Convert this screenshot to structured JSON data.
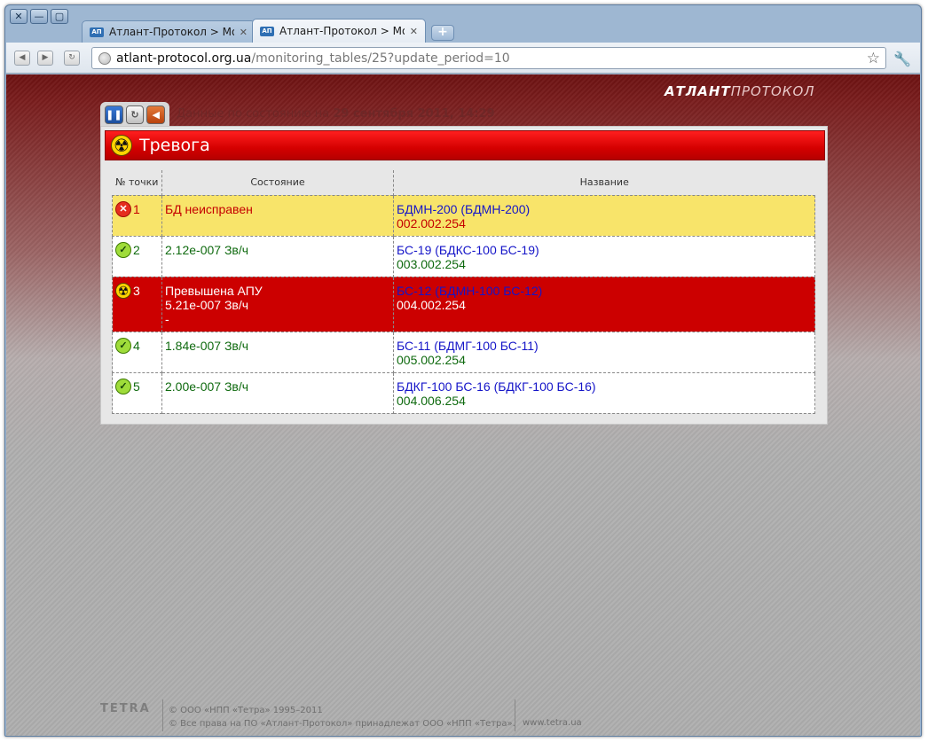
{
  "window": {
    "controls": [
      "✕",
      "—",
      "▢"
    ]
  },
  "tabs": [
    {
      "favicon": "АП",
      "title": "Атлант-Протокол > Мо...",
      "close": "✕"
    },
    {
      "favicon": "АП",
      "title": "Атлант-Протокол > Мо...",
      "close": "✕",
      "active": true
    }
  ],
  "toolbar": {
    "url_host": "atlant-protocol.org.ua",
    "url_path": "/monitoring_tables/25?update_period=10"
  },
  "page": {
    "brand_bold": "АТЛАНТ",
    "brand_light": "ПРОТОКОЛ",
    "status_prefix": "Данные по состоянию на",
    "status_date": "29 сентября 2011, 14:29",
    "alarm_title": "Тревога",
    "columns": [
      "№ точки",
      "Состояние",
      "Название"
    ],
    "rows": [
      {
        "status": "error",
        "num": "1",
        "state": [
          "БД неисправен"
        ],
        "name": "БДМН-200 (БДМН-200)",
        "code": "002.002.254",
        "style": "yellow"
      },
      {
        "status": "ok",
        "num": "2",
        "state": [
          "2.12е-007 Зв/ч"
        ],
        "name": "БС-19 (БДКС-100 БС-19)",
        "code": "003.002.254",
        "style": "white"
      },
      {
        "status": "alarm",
        "num": "3",
        "state": [
          "Превышена АПУ",
          "5.21е-007 Зв/ч",
          "-"
        ],
        "name": "БС-12 (БДМН-100 БС-12)",
        "code": "004.002.254",
        "style": "red"
      },
      {
        "status": "ok",
        "num": "4",
        "state": [
          "1.84е-007 Зв/ч"
        ],
        "name": "БС-11 (БДМГ-100 БС-11)",
        "code": "005.002.254",
        "style": "white"
      },
      {
        "status": "ok",
        "num": "5",
        "state": [
          "2.00е-007 Зв/ч"
        ],
        "name": "БДКГ-100 БС-16 (БДКГ-100 БС-16)",
        "code": "004.006.254",
        "style": "white"
      }
    ],
    "footer": {
      "logo": "TETRA",
      "line1": "© ООО «НПП «Тетра» 1995–2011",
      "line2": "© Все права на ПО «Атлант-Протокол» принадлежат ООО «НПП «Тетра».",
      "www": "www.tetra.ua"
    }
  }
}
